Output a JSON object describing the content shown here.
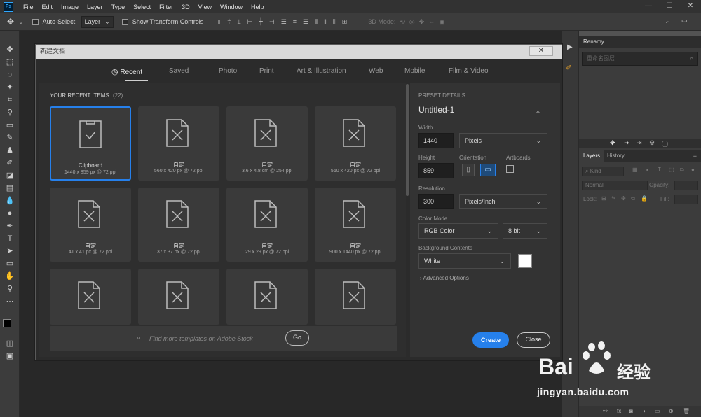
{
  "app": {
    "logo": "Ps"
  },
  "menubar": {
    "items": [
      "File",
      "Edit",
      "Image",
      "Layer",
      "Type",
      "Select",
      "Filter",
      "3D",
      "View",
      "Window",
      "Help"
    ],
    "controls": [
      "—",
      "☐",
      "✕"
    ]
  },
  "options": {
    "auto_select_label": "Auto-Select:",
    "layer_value": "Layer",
    "show_transform_label": "Show Transform Controls",
    "mode_3d_label": "3D Mode:"
  },
  "dialog": {
    "title": "新建文档",
    "close_glyph": "✕",
    "tabs": [
      "Recent",
      "Saved",
      "Photo",
      "Print",
      "Art & Illustration",
      "Web",
      "Mobile",
      "Film & Video"
    ],
    "recent_header": "YOUR RECENT ITEMS",
    "recent_count": "(22)",
    "items": [
      {
        "name": "Clipboard",
        "size": "1440 x 859 px @ 72 ppi"
      },
      {
        "name": "自定",
        "size": "560 x 420 px @ 72 ppi"
      },
      {
        "name": "自定",
        "size": "3.6 x 4.8 cm @ 254 ppi"
      },
      {
        "name": "自定",
        "size": "560 x 420 px @ 72 ppi"
      },
      {
        "name": "自定",
        "size": "41 x 41 px @ 72 ppi"
      },
      {
        "name": "自定",
        "size": "37 x 37 px @ 72 ppi"
      },
      {
        "name": "自定",
        "size": "29 x 29 px @ 72 ppi"
      },
      {
        "name": "自定",
        "size": "900 x 1440 px @ 72 ppi"
      },
      {
        "name": "",
        "size": ""
      },
      {
        "name": "",
        "size": ""
      },
      {
        "name": "",
        "size": ""
      },
      {
        "name": "",
        "size": ""
      }
    ],
    "search_placeholder": "Find more templates on Adobe Stock",
    "go_label": "Go",
    "preset": {
      "header": "PRESET DETAILS",
      "name": "Untitled-1",
      "width_label": "Width",
      "width_value": "1440",
      "width_unit": "Pixels",
      "height_label": "Height",
      "height_value": "859",
      "orientation_label": "Orientation",
      "artboards_label": "Artboards",
      "resolution_label": "Resolution",
      "resolution_value": "300",
      "resolution_unit": "Pixels/Inch",
      "color_mode_label": "Color Mode",
      "color_mode": "RGB Color",
      "bit_depth": "8 bit",
      "background_label": "Background Contents",
      "background": "White",
      "advanced_label": "Advanced Options"
    },
    "create_label": "Create",
    "close_label": "Close"
  },
  "right_panel": {
    "renamy_title": "Renamy",
    "renamy_placeholder": "重命名图层",
    "tabs": [
      "Layers",
      "History"
    ],
    "kind_label": "Kind",
    "blend_mode": "Normal",
    "opacity_label": "Opacity:",
    "lock_label": "Lock:",
    "fill_label": "Fill:"
  },
  "watermark": {
    "brand": "Bai",
    "brand_cn": "经验",
    "url": "jingyan.baidu.com"
  },
  "colors": {
    "accent": "#2680eb",
    "dialog_bg": "#2b2b2b",
    "card_bg": "#3a3a3a"
  }
}
